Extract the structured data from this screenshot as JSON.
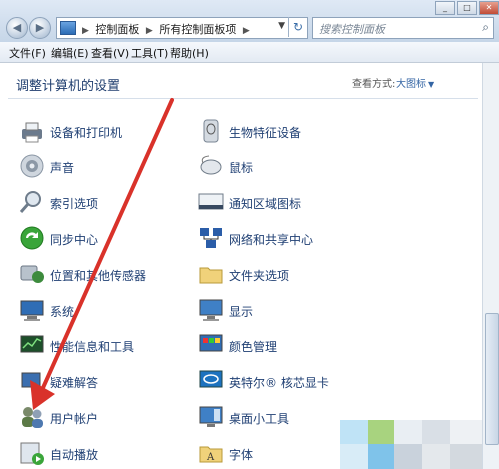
{
  "address": {
    "breadcrumbs": [
      "控制面板",
      "所有控制面板项"
    ],
    "search_placeholder": "搜索控制面板"
  },
  "menu": [
    "文件(F)",
    "编辑(E)",
    "查看(V)",
    "工具(T)",
    "帮助(H)"
  ],
  "content": {
    "heading": "调整计算机的设置",
    "view_by_label": "查看方式:",
    "view_by_value": "大图标"
  },
  "items_left": [
    "设备和打印机",
    "声音",
    "索引选项",
    "同步中心",
    "位置和其他传感器",
    "系统",
    "性能信息和工具",
    "疑难解答",
    "用户帐户",
    "自动播放"
  ],
  "items_right": [
    "生物特征设备",
    "鼠标",
    "通知区域图标",
    "网络和共享中心",
    "文件夹选项",
    "显示",
    "颜色管理",
    "英特尔® 核芯显卡",
    "桌面小工具",
    "字体"
  ],
  "colors": {
    "arrow": "#d9322a",
    "link": "#1f3f73",
    "heading": "#1e3d6e"
  }
}
